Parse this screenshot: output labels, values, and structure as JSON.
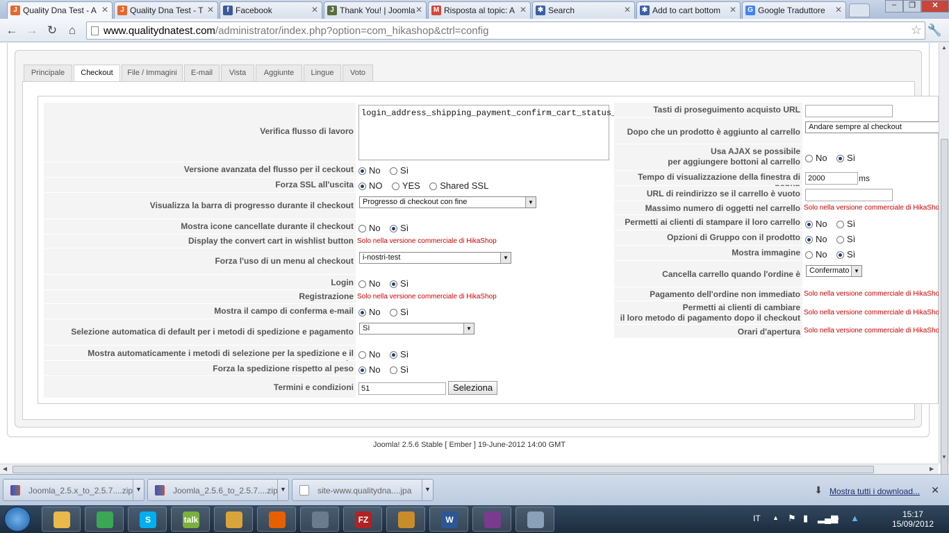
{
  "browser": {
    "tabs": [
      {
        "label": "Quality Dna Test - A",
        "icon": "joomla-icon",
        "color": "#e8672b"
      },
      {
        "label": "Quality Dna Test - T",
        "icon": "joomla-icon",
        "color": "#e8672b"
      },
      {
        "label": "Facebook",
        "icon": "facebook-icon",
        "color": "#3b5998"
      },
      {
        "label": "Thank You! | Joomla",
        "icon": "joomla-icon",
        "color": "#5a6e3b"
      },
      {
        "label": "Risposta al topic: A",
        "icon": "gmail-icon",
        "color": "#d44638"
      },
      {
        "label": "Search",
        "icon": "joomla-icon",
        "color": "#3a5fa5"
      },
      {
        "label": "Add to cart bottom",
        "icon": "joomla-icon",
        "color": "#3a5fa5"
      },
      {
        "label": "Google Traduttore",
        "icon": "google-translate-icon",
        "color": "#4285f4"
      }
    ],
    "url_host": "www.qualitydnatest.com",
    "url_path": "/administrator/index.php?option=com_hikashop&ctrl=config"
  },
  "page_tabs": [
    "Principale",
    "Checkout",
    "File / Immagini",
    "E-mail",
    "Vista",
    "Aggiunte",
    "Lingue",
    "Voto"
  ],
  "left": {
    "workflow": {
      "label": "Verifica flusso di lavoro",
      "value": "login_address_shipping_payment_confirm_cart_status_fields,end"
    },
    "advanced_flow": {
      "label": "Versione avanzata del flusso per il ceckout",
      "opts": [
        "No",
        "Sì"
      ]
    },
    "force_ssl": {
      "label": "Forza SSL all'uscita",
      "opts": [
        "NO",
        "YES",
        "Shared SSL"
      ]
    },
    "progress_bar": {
      "label": "Visualizza la barra di progresso durante il checkout",
      "value": "Progresso di checkout con fine"
    },
    "show_deleted_icons": {
      "label": "Mostra icone cancellate durante il checkout",
      "opts": [
        "No",
        "Sì"
      ]
    },
    "convert_cart": {
      "label": "Display the convert cart in wishlist button",
      "value": "Solo nella versione commerciale di HikaShop"
    },
    "force_menu": {
      "label": "Forza l'uso di un menu al checkout",
      "value": "i-nostri-test"
    },
    "login": {
      "label": "Login",
      "opts": [
        "No",
        "Sì"
      ]
    },
    "registration": {
      "label": "Registrazione",
      "value": "Solo nella versione commerciale di HikaShop"
    },
    "confirm_email": {
      "label": "Mostra il campo di conferma e-mail",
      "opts": [
        "No",
        "Sì"
      ]
    },
    "auto_select": {
      "label": "Selezione automatica di default per i metodi di spedizione e pagamento",
      "value": "Sì"
    },
    "auto_show_methods": {
      "label": "Mostra automaticamente i metodi di selezione per la spedizione e il pagamento",
      "opts": [
        "No",
        "Sì"
      ]
    },
    "force_shipping": {
      "label": "Forza la spedizione rispetto al peso",
      "opts": [
        "No",
        "Sì"
      ]
    },
    "terms": {
      "label": "Termini e condizioni",
      "value": "51",
      "button": "Seleziona"
    }
  },
  "right": {
    "continue_url": {
      "label": "Tasti di proseguimento acquisto URL",
      "value": ""
    },
    "after_add": {
      "label": "Dopo che un prodotto è aggiunto al carrello",
      "value": "Andare sempre al checkout"
    },
    "ajax_line1": "Usa AJAX se possibile",
    "ajax_line2": "per aggiungere bottoni al carrello",
    "ajax_opts": [
      "No",
      "Sì"
    ],
    "popup_time": {
      "label": "Tempo di visualizzazione della finestra di popup",
      "value": "2000",
      "unit": "ms"
    },
    "empty_cart_url": {
      "label": "URL di reindirizzo se il carrello è vuoto",
      "value": ""
    },
    "max_items": {
      "label": "Massimo numero di oggetti nel carrello",
      "value": "Solo nella versione commerciale di HikaShop"
    },
    "print_cart": {
      "label": "Permetti ai clienti di stampare il loro carrello",
      "opts": [
        "No",
        "Sì"
      ]
    },
    "group_options": {
      "label": "Opzioni di Gruppo con il prodotto",
      "opts": [
        "No",
        "Sì"
      ]
    },
    "show_image": {
      "label": "Mostra immagine",
      "opts": [
        "No",
        "Sì"
      ]
    },
    "clear_cart": {
      "label": "Cancella carrello quando l'ordine è",
      "value": "Confermato"
    },
    "non_immediate": {
      "label": "Pagamento dell'ordine non immediato",
      "value": "Solo nella versione commerciale di HikaShop"
    },
    "change_pay_line1": "Permetti ai clienti di cambiare",
    "change_pay_line2": "il loro metodo di pagamento dopo il checkout",
    "change_pay_value": "Solo nella versione commerciale di HikaShop",
    "opening_hours": {
      "label": "Orari d'apertura",
      "value": "Solo nella versione commerciale di HikaShop"
    }
  },
  "footer": {
    "version": "Joomla! 2.5.6 Stable [ Ember ] 19-June-2012 14:00 GMT"
  },
  "downloads": {
    "items": [
      {
        "label": "Joomla_2.5.x_to_2.5.7....zip"
      },
      {
        "label": "Joomla_2.5.6_to_2.5.7....zip"
      },
      {
        "label": "site-www.qualitydna....jpa"
      }
    ],
    "show_all": "Mostra tutti i download..."
  },
  "taskbar": {
    "lang": "IT",
    "time": "15:17",
    "date": "15/09/2012",
    "apps": [
      {
        "name": "explorer-icon",
        "color": "#e9b94a",
        "glyph": ""
      },
      {
        "name": "chrome-icon",
        "color": "#3aa757",
        "glyph": ""
      },
      {
        "name": "skype-icon",
        "color": "#00aff0",
        "glyph": "S"
      },
      {
        "name": "gtalk-icon",
        "color": "#7bb03c",
        "glyph": "talk"
      },
      {
        "name": "paint-icon",
        "color": "#d9a53b",
        "glyph": ""
      },
      {
        "name": "firefox-icon",
        "color": "#e66000",
        "glyph": ""
      },
      {
        "name": "xampp-icon",
        "color": "#6a7b8e",
        "glyph": ""
      },
      {
        "name": "filezilla-icon",
        "color": "#b22222",
        "glyph": "FZ"
      },
      {
        "name": "palette-icon",
        "color": "#c98c2b",
        "glyph": ""
      },
      {
        "name": "word-icon",
        "color": "#2b5797",
        "glyph": "W"
      },
      {
        "name": "winrar-icon",
        "color": "#7a3b8f",
        "glyph": ""
      },
      {
        "name": "calculator-icon",
        "color": "#8aa0b8",
        "glyph": ""
      }
    ]
  }
}
